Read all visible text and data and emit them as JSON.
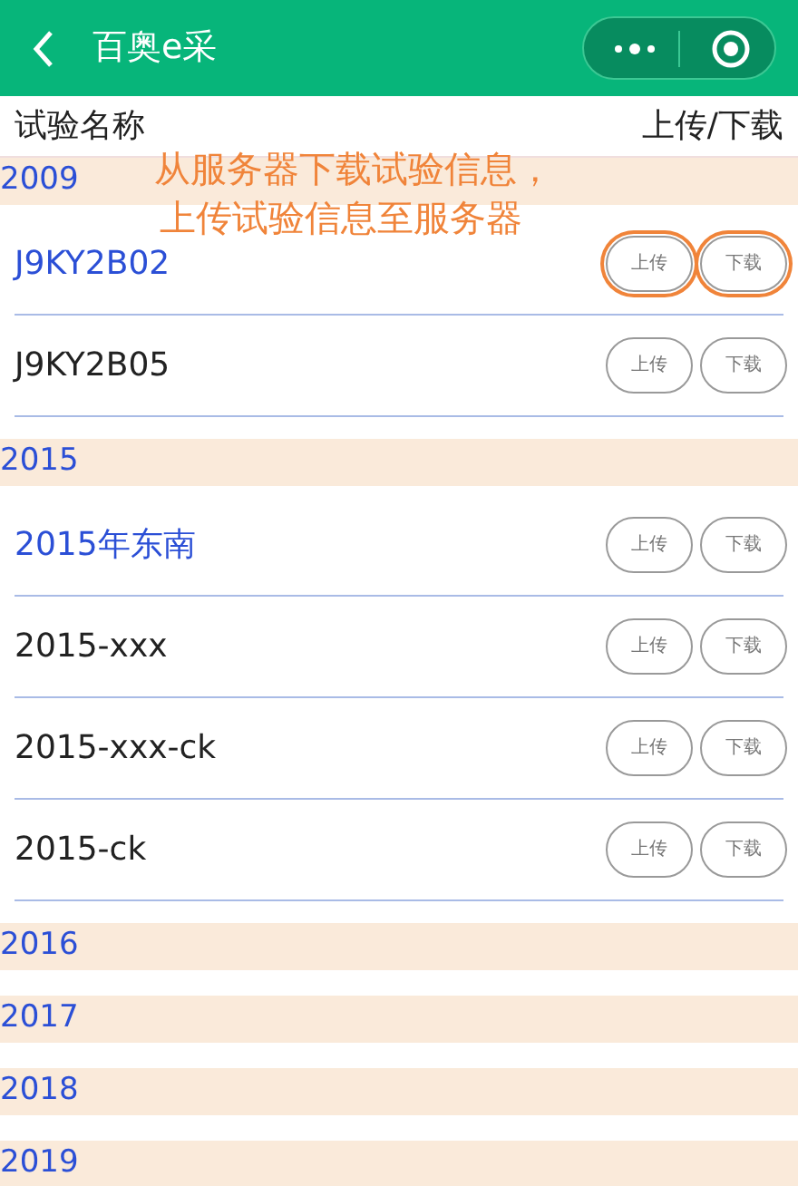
{
  "nav_bar": {
    "title": "百奥e采"
  },
  "list_header": {
    "name_column": "试验名称",
    "action_column": "上传/下载"
  },
  "annotation": {
    "lines": [
      "从服务器下载试验信息，",
      "上传试验信息至服务器"
    ]
  },
  "groups": [
    {
      "year": "2009",
      "items": [
        {
          "name": "J9KY2B02",
          "highlighted": true,
          "circled": true,
          "upload": "上传",
          "download": "下载"
        },
        {
          "name": "J9KY2B05",
          "highlighted": false,
          "circled": false,
          "upload": "上传",
          "download": "下载"
        }
      ]
    },
    {
      "year": "2015",
      "items": [
        {
          "name": "2015年东南",
          "highlighted": true,
          "circled": false,
          "upload": "上传",
          "download": "下载"
        },
        {
          "name": "2015-xxx",
          "highlighted": false,
          "circled": false,
          "upload": "上传",
          "download": "下载"
        },
        {
          "name": "2015-xxx-ck",
          "highlighted": false,
          "circled": false,
          "upload": "上传",
          "download": "下载"
        },
        {
          "name": "2015-ck",
          "highlighted": false,
          "circled": false,
          "upload": "上传",
          "download": "下载"
        }
      ]
    },
    {
      "year": "2016"
    },
    {
      "year": "2017"
    },
    {
      "year": "2018"
    },
    {
      "year": "2019"
    }
  ]
}
